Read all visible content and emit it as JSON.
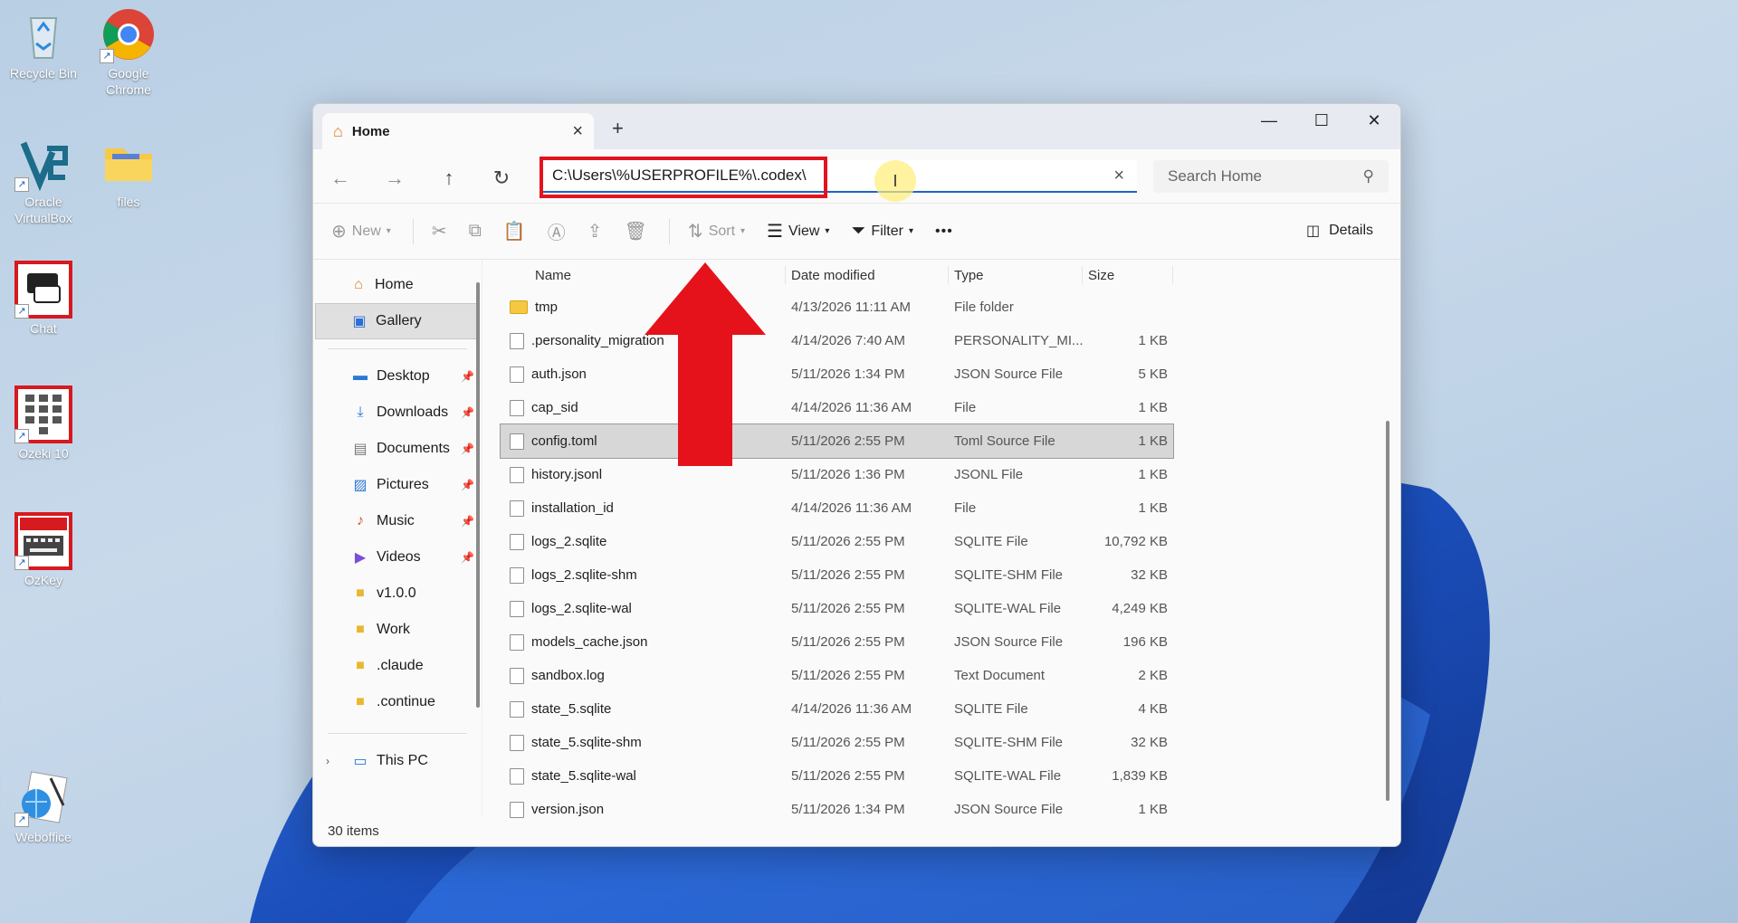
{
  "desktop": {
    "icons": [
      {
        "label": "Recycle Bin"
      },
      {
        "label": "Google Chrome"
      },
      {
        "label": "Oracle VirtualBox"
      },
      {
        "label": "files"
      },
      {
        "label": "Chat"
      },
      {
        "label": "Ozeki 10"
      },
      {
        "label": "OzKey"
      },
      {
        "label": "Weboffice"
      }
    ]
  },
  "window": {
    "tab_title": "Home",
    "address": "C:\\Users\\%USERPROFILE%\\.codex\\",
    "search_placeholder": "Search Home",
    "toolbar": {
      "new": "New",
      "sort": "Sort",
      "view": "View",
      "filter": "Filter",
      "more": "•••",
      "details": "Details"
    },
    "nav": {
      "home": "Home",
      "gallery": "Gallery",
      "pinned": [
        {
          "label": "Desktop"
        },
        {
          "label": "Downloads"
        },
        {
          "label": "Documents"
        },
        {
          "label": "Pictures"
        },
        {
          "label": "Music"
        },
        {
          "label": "Videos"
        },
        {
          "label": "v1.0.0"
        },
        {
          "label": "Work"
        },
        {
          "label": ".claude"
        },
        {
          "label": ".continue"
        }
      ],
      "this_pc": "This PC"
    },
    "columns": {
      "name": "Name",
      "date": "Date modified",
      "type": "Type",
      "size": "Size"
    },
    "files": [
      {
        "name": "tmp",
        "date": "4/13/2026 11:11 AM",
        "type": "File folder",
        "size": ""
      },
      {
        "name": ".personality_migration",
        "date": "4/14/2026 7:40 AM",
        "type": "PERSONALITY_MI...",
        "size": "1 KB"
      },
      {
        "name": "auth.json",
        "date": "5/11/2026 1:34 PM",
        "type": "JSON Source File",
        "size": "5 KB"
      },
      {
        "name": "cap_sid",
        "date": "4/14/2026 11:36 AM",
        "type": "File",
        "size": "1 KB"
      },
      {
        "name": "config.toml",
        "date": "5/11/2026 2:55 PM",
        "type": "Toml Source File",
        "size": "1 KB"
      },
      {
        "name": "history.jsonl",
        "date": "5/11/2026 1:36 PM",
        "type": "JSONL File",
        "size": "1 KB"
      },
      {
        "name": "installation_id",
        "date": "4/14/2026 11:36 AM",
        "type": "File",
        "size": "1 KB"
      },
      {
        "name": "logs_2.sqlite",
        "date": "5/11/2026 2:55 PM",
        "type": "SQLITE File",
        "size": "10,792 KB"
      },
      {
        "name": "logs_2.sqlite-shm",
        "date": "5/11/2026 2:55 PM",
        "type": "SQLITE-SHM File",
        "size": "32 KB"
      },
      {
        "name": "logs_2.sqlite-wal",
        "date": "5/11/2026 2:55 PM",
        "type": "SQLITE-WAL File",
        "size": "4,249 KB"
      },
      {
        "name": "models_cache.json",
        "date": "5/11/2026 2:55 PM",
        "type": "JSON Source File",
        "size": "196 KB"
      },
      {
        "name": "sandbox.log",
        "date": "5/11/2026 2:55 PM",
        "type": "Text Document",
        "size": "2 KB"
      },
      {
        "name": "state_5.sqlite",
        "date": "4/14/2026 11:36 AM",
        "type": "SQLITE File",
        "size": "4 KB"
      },
      {
        "name": "state_5.sqlite-shm",
        "date": "5/11/2026 2:55 PM",
        "type": "SQLITE-SHM File",
        "size": "32 KB"
      },
      {
        "name": "state_5.sqlite-wal",
        "date": "5/11/2026 2:55 PM",
        "type": "SQLITE-WAL File",
        "size": "1,839 KB"
      },
      {
        "name": "version.json",
        "date": "5/11/2026 1:34 PM",
        "type": "JSON Source File",
        "size": "1 KB"
      }
    ],
    "status": "30 items"
  }
}
